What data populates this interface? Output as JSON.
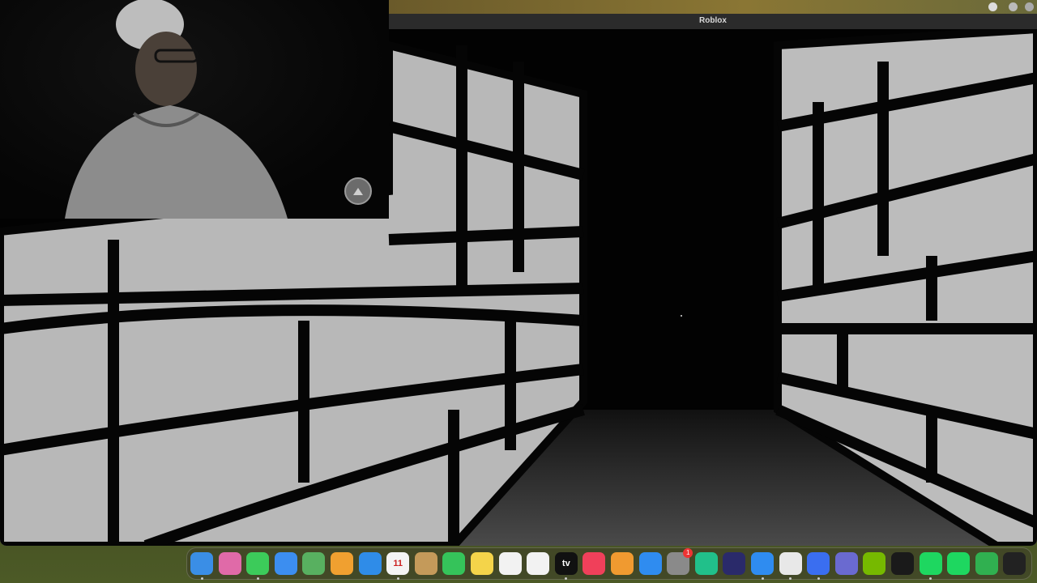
{
  "window": {
    "title": "Roblox"
  },
  "dock": {
    "apps": [
      {
        "name": "finder-icon",
        "label": "",
        "color": "#3a8ee6"
      },
      {
        "name": "launchpad-icon",
        "label": "",
        "color": "#e06aa8"
      },
      {
        "name": "messages-icon",
        "label": "",
        "color": "#3ccb5a"
      },
      {
        "name": "mail-icon",
        "label": "",
        "color": "#3c8ef0"
      },
      {
        "name": "maps-icon",
        "label": "",
        "color": "#58b060"
      },
      {
        "name": "photos-icon",
        "label": "",
        "color": "#f0a030"
      },
      {
        "name": "keynote-icon",
        "label": "",
        "color": "#2f8ce8"
      },
      {
        "name": "calendar-icon",
        "label": "11",
        "color": "#f4f4f4"
      },
      {
        "name": "contacts-icon",
        "label": "",
        "color": "#c49a5a"
      },
      {
        "name": "facetime-icon",
        "label": "",
        "color": "#35c35a"
      },
      {
        "name": "notes-icon",
        "label": "",
        "color": "#f4d44a"
      },
      {
        "name": "reminders-icon",
        "label": "",
        "color": "#f2f2f2"
      },
      {
        "name": "freeform-icon",
        "label": "",
        "color": "#f2f2f2"
      },
      {
        "name": "apple-tv-icon",
        "label": "tv",
        "color": "#111111"
      },
      {
        "name": "music-icon",
        "label": "",
        "color": "#f0405a"
      },
      {
        "name": "pages-icon",
        "label": "",
        "color": "#f09a30"
      },
      {
        "name": "app-store-icon",
        "label": "",
        "color": "#2f8cf0"
      },
      {
        "name": "system-settings-icon",
        "label": "",
        "color": "#8a8a8a"
      },
      {
        "name": "pycharm-icon",
        "label": "",
        "color": "#21c08a"
      },
      {
        "name": "quicktime-icon",
        "label": "",
        "color": "#2a2a6a"
      },
      {
        "name": "safari-icon",
        "label": "",
        "color": "#2f8cf0"
      },
      {
        "name": "chrome-icon",
        "label": "",
        "color": "#e8e8e8"
      },
      {
        "name": "roblox-icon",
        "label": "",
        "color": "#3a6ef0"
      },
      {
        "name": "roblox-studio-icon",
        "label": "",
        "color": "#6a6ad0"
      },
      {
        "name": "nvidia-icon",
        "label": "",
        "color": "#76b900"
      },
      {
        "name": "opera-icon",
        "label": "",
        "color": "#1a1a1a"
      },
      {
        "name": "spotify-icon",
        "label": "",
        "color": "#1ed760"
      },
      {
        "name": "spotify-alt-icon",
        "label": "",
        "color": "#1ed760"
      },
      {
        "name": "numbers-icon",
        "label": "",
        "color": "#30b050"
      },
      {
        "name": "terminal-icon",
        "label": "",
        "color": "#222222"
      }
    ],
    "settings_badge": "1"
  }
}
